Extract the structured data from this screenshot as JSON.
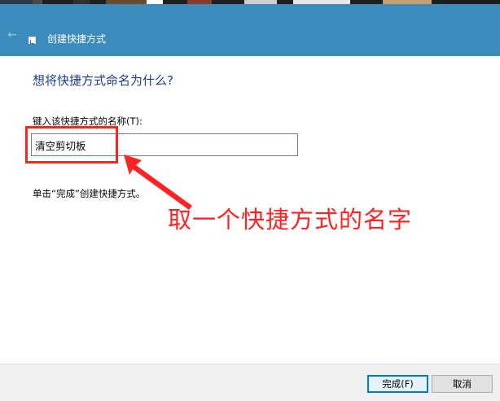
{
  "titlebar": {
    "title": "创建快捷方式",
    "back_icon": "back-arrow-icon",
    "app_icon": "shortcut-icon",
    "color": "#3b8bbd"
  },
  "main": {
    "heading": "想将快捷方式命名为什么?",
    "field_label": "键入该快捷方式的名称(T):",
    "name_value": "清空剪切板",
    "hint": "单击“完成”创建快捷方式。"
  },
  "annotation": {
    "text": "取一个快捷方式的名字",
    "color": "#ff2222"
  },
  "footer": {
    "finish_label": "完成(F)",
    "cancel_label": "取消"
  }
}
